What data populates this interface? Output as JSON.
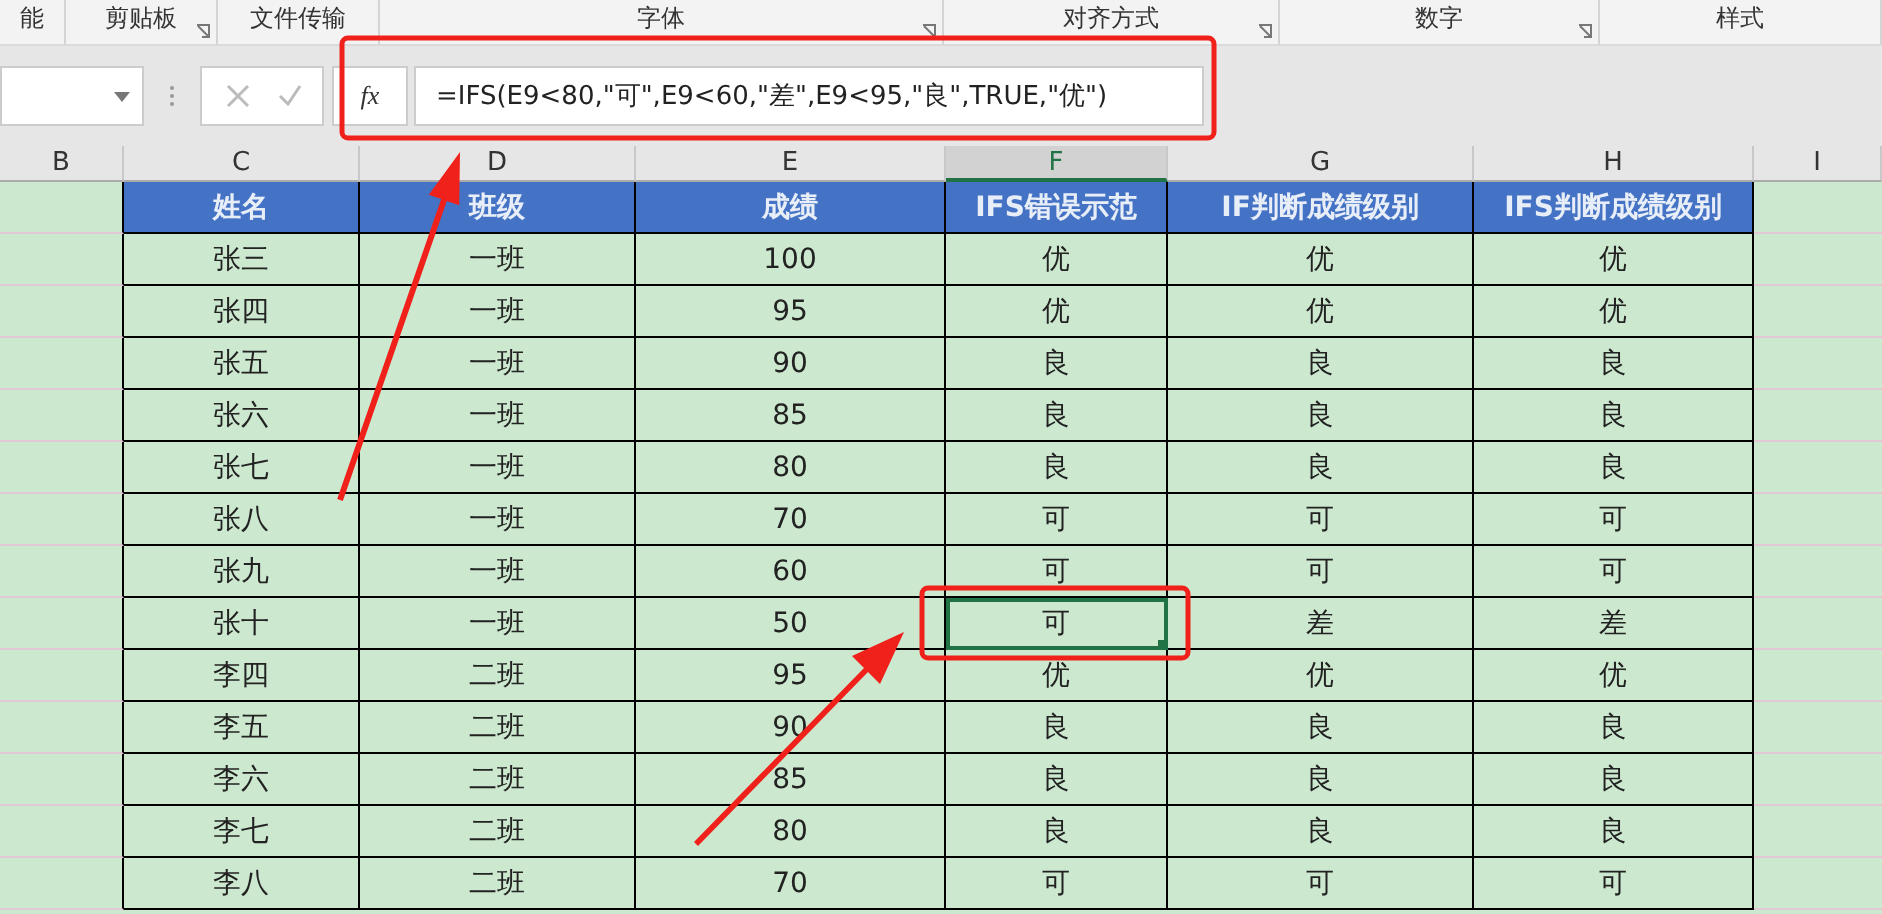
{
  "ribbon_groups": [
    {
      "label": "能",
      "launcher": false
    },
    {
      "label": "剪贴板",
      "launcher": true
    },
    {
      "label": "文件传输",
      "launcher": false
    },
    {
      "label": "字体",
      "launcher": true
    },
    {
      "label": "对齐方式",
      "launcher": true
    },
    {
      "label": "数字",
      "launcher": true
    },
    {
      "label": "样式",
      "launcher": false
    }
  ],
  "formula_bar": {
    "fx": "fx",
    "formula": "=IFS(E9<80,\"可\",E9<60,\"差\",E9<95,\"良\",TRUE,\"优\")"
  },
  "columns": [
    {
      "label": "B",
      "selected": false
    },
    {
      "label": "C",
      "selected": false
    },
    {
      "label": "D",
      "selected": false
    },
    {
      "label": "E",
      "selected": false
    },
    {
      "label": "F",
      "selected": true
    },
    {
      "label": "G",
      "selected": false
    },
    {
      "label": "H",
      "selected": false
    },
    {
      "label": "I",
      "selected": false
    }
  ],
  "table": {
    "headers": [
      "姓名",
      "班级",
      "成绩",
      "IFS错误示范",
      "IF判断成绩级别",
      "IFS判断成绩级别"
    ],
    "rows": [
      {
        "cells": [
          "张三",
          "一班",
          "100",
          "优",
          "优",
          "优"
        ],
        "selected": false
      },
      {
        "cells": [
          "张四",
          "一班",
          "95",
          "优",
          "优",
          "优"
        ],
        "selected": false
      },
      {
        "cells": [
          "张五",
          "一班",
          "90",
          "良",
          "良",
          "良"
        ],
        "selected": false
      },
      {
        "cells": [
          "张六",
          "一班",
          "85",
          "良",
          "良",
          "良"
        ],
        "selected": false
      },
      {
        "cells": [
          "张七",
          "一班",
          "80",
          "良",
          "良",
          "良"
        ],
        "selected": false
      },
      {
        "cells": [
          "张八",
          "一班",
          "70",
          "可",
          "可",
          "可"
        ],
        "selected": false
      },
      {
        "cells": [
          "张九",
          "一班",
          "60",
          "可",
          "可",
          "可"
        ],
        "selected": false
      },
      {
        "cells": [
          "张十",
          "一班",
          "50",
          "可",
          "差",
          "差"
        ],
        "selected": true
      },
      {
        "cells": [
          "李四",
          "二班",
          "95",
          "优",
          "优",
          "优"
        ],
        "selected": false
      },
      {
        "cells": [
          "李五",
          "二班",
          "90",
          "良",
          "良",
          "良"
        ],
        "selected": false
      },
      {
        "cells": [
          "李六",
          "二班",
          "85",
          "良",
          "良",
          "良"
        ],
        "selected": false
      },
      {
        "cells": [
          "李七",
          "二班",
          "80",
          "良",
          "良",
          "良"
        ],
        "selected": false
      },
      {
        "cells": [
          "李八",
          "二班",
          "70",
          "可",
          "可",
          "可"
        ],
        "selected": false
      }
    ]
  }
}
